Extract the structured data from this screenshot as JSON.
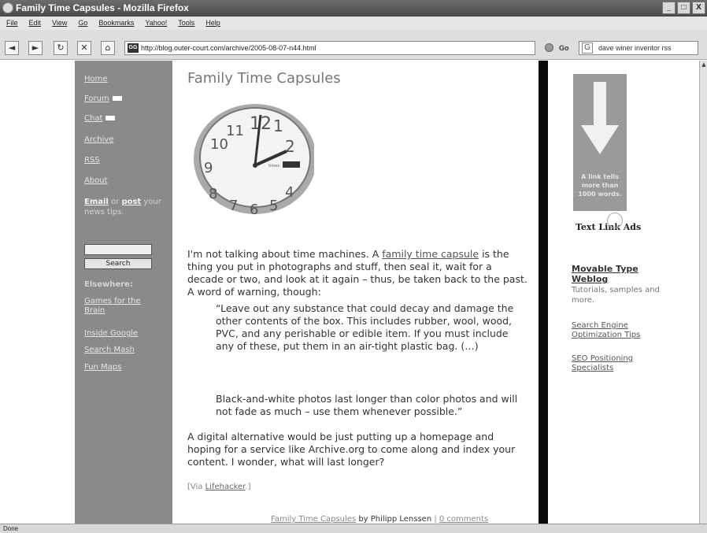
{
  "window": {
    "title": "Family Time Capsules - Mozilla Firefox",
    "minimize": "_",
    "maximize": "□",
    "close": "X"
  },
  "menu": [
    "File",
    "Edit",
    "View",
    "Go",
    "Bookmarks",
    "Yahoo!",
    "Tools",
    "Help"
  ],
  "nav": {
    "url": "http://blog.outer-court.com/archive/2005-08-07-n44.html",
    "go_label": "Go",
    "search_value": "dave winer inventor rss",
    "favicon_text": "GG"
  },
  "left_nav": {
    "links": [
      "Home",
      "Forum",
      "Chat",
      "Archive",
      "RSS",
      "About"
    ],
    "email_link": "Email",
    "or_text": " or ",
    "post_link": "post",
    "email_rest": " your news tips.",
    "search_button": "Search",
    "elsewhere_heading": "Elsewhere:",
    "elsewhere_links": [
      "Games for the Brain",
      "Inside Google",
      "Search Mash",
      "Fun Maps"
    ]
  },
  "post": {
    "title": "Family Time Capsules",
    "p1_a": "I'm not talking about time machines. A ",
    "p1_link": "family time capsule",
    "p1_b": " is the thing you put in photographs and stuff, then seal it, wait for a decade or two, and look at it again – thus, be taken back to the past. A word of warning, though:",
    "quote1": "“Leave out any substance that could decay and damage the other contents of the box. This includes rubber, wool, wood, PVC, and any perishable or edible item. If you must include any of these, put them in an air-tight plastic bag. (…)",
    "quote2": "Black-and-white photos last longer than color photos and will not fade as much – use them whenever possible.”",
    "p3": "A digital alternative would be just putting up a homepage and hoping for a service like Archive.org to come along and index your content. I wonder, what will last longer?",
    "via_prefix": "[Via ",
    "via_link": "Lifehacker",
    "via_suffix": ".]",
    "footer_title": "Family Time Capsules",
    "footer_by": " by Philipp Lenssen",
    "footer_sep": " | ",
    "footer_comments": "0 comments"
  },
  "clock": {
    "numbers": [
      "12",
      "1",
      "2",
      "4",
      "5",
      "6",
      "7",
      "8",
      "9",
      "10",
      "11"
    ],
    "brand": "timex"
  },
  "sidebar": {
    "ad_text": "A link tells more than 1000 words.",
    "text_link_ads": "Text Link Ads",
    "mt_link": "Movable Type Weblog",
    "mt_desc": "Tutorials, samples and more.",
    "se_link": "Search Engine Optimization Tips",
    "seo_link": "SEO Positioning Specialists"
  },
  "status": "Done"
}
